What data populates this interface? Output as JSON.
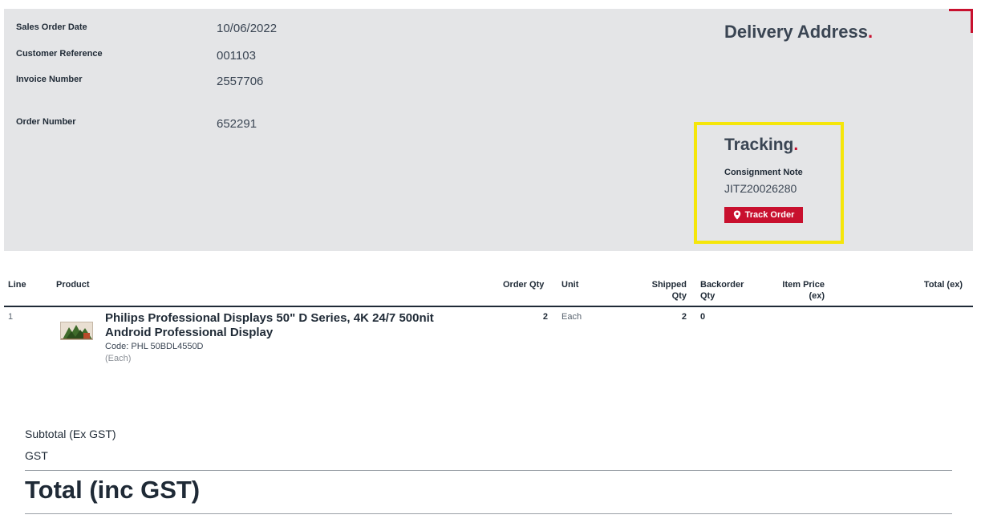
{
  "order_info": {
    "sales_order_date_label": "Sales Order Date",
    "sales_order_date_value": "10/06/2022",
    "customer_reference_label": "Customer Reference",
    "customer_reference_value": "001103",
    "invoice_number_label": "Invoice Number",
    "invoice_number_value": "2557706",
    "order_number_label": "Order Number",
    "order_number_value": "652291"
  },
  "delivery": {
    "heading": "Delivery Address",
    "heading_dot": "."
  },
  "tracking": {
    "heading": "Tracking",
    "heading_dot": ".",
    "consignment_label": "Consignment Note",
    "consignment_value": "JITZ20026280",
    "track_button_label": "Track Order",
    "track_button_icon": "map-pin-icon"
  },
  "table": {
    "headers": {
      "line": "Line",
      "product": "Product",
      "order_qty": "Order Qty",
      "unit": "Unit",
      "shipped_qty_1": "Shipped",
      "shipped_qty_2": "Qty",
      "backorder_qty_1": "Backorder",
      "backorder_qty_2": "Qty",
      "item_price_1": "Item Price",
      "item_price_2": "(ex)",
      "total_ex": "Total (ex)"
    },
    "rows": [
      {
        "line": "1",
        "product_name": "Philips Professional Displays 50\" D Series, 4K 24/7 500nit Android Professional Display",
        "product_code": "Code: PHL 50BDL4550D",
        "product_unit": "(Each)",
        "order_qty": "2",
        "unit": "Each",
        "shipped_qty": "2",
        "backorder_qty": "0"
      }
    ]
  },
  "summary": {
    "subtotal_label": "Subtotal (Ex GST)",
    "gst_label": "GST",
    "total_label": "Total (inc GST)"
  },
  "colors": {
    "accent": "#c8102e",
    "highlight": "#f5e60a",
    "panel_bg": "#e4e5e7",
    "text_dark": "#1f2a36"
  }
}
